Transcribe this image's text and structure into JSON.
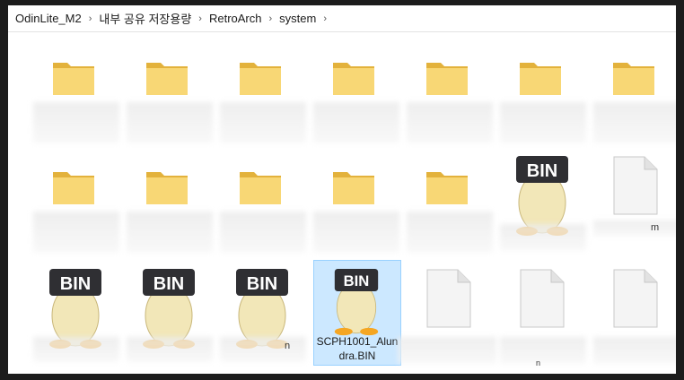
{
  "breadcrumb": {
    "items": [
      "OdinLite_M2",
      "내부 공유 저장용량",
      "RetroArch",
      "system"
    ],
    "separator": "›"
  },
  "icons": {
    "bin_badge_text": "BIN"
  },
  "files": {
    "selected_name": "SCPH1001_Alundra.BIN",
    "partial_suffix_a": "n",
    "partial_suffix_b": "n",
    "partial_suffix_c": "m"
  }
}
